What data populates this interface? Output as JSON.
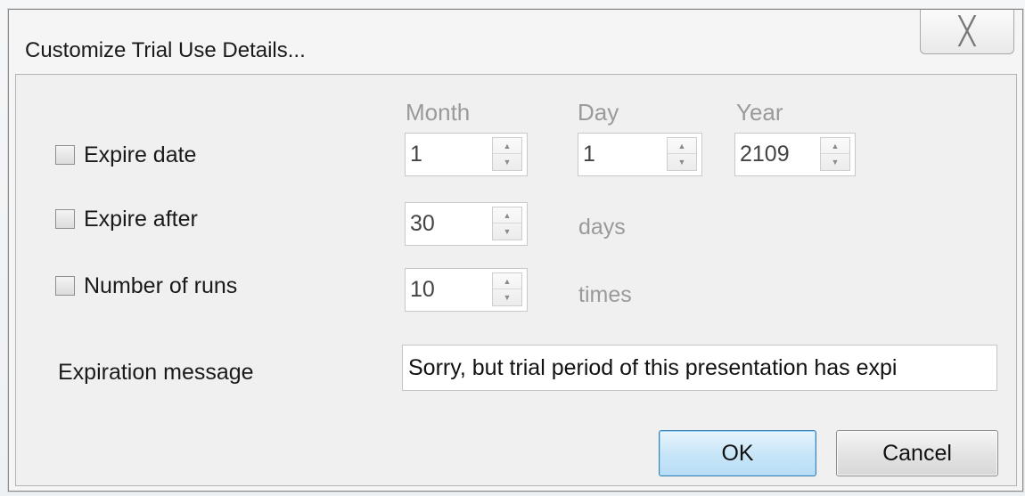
{
  "dialog": {
    "title": "Customize Trial Use Details...",
    "close_icon_glyph": "╳"
  },
  "columns": {
    "month": "Month",
    "day": "Day",
    "year": "Year"
  },
  "expire_date": {
    "label": "Expire date",
    "checked": false,
    "month": "1",
    "day": "1",
    "year": "2109"
  },
  "expire_after": {
    "label": "Expire after",
    "checked": false,
    "value": "30",
    "unit": "days"
  },
  "number_of_runs": {
    "label": "Number of runs",
    "checked": false,
    "value": "10",
    "unit": "times"
  },
  "expiration_message": {
    "label": "Expiration message",
    "value": "Sorry, but trial period of this presentation has expi"
  },
  "buttons": {
    "ok": "OK",
    "cancel": "Cancel"
  },
  "spin_glyphs": {
    "up": "▲",
    "down": "▼"
  },
  "colors": {
    "ok_border": "#3c7fb1",
    "disabled_text": "#9a9a9a"
  }
}
